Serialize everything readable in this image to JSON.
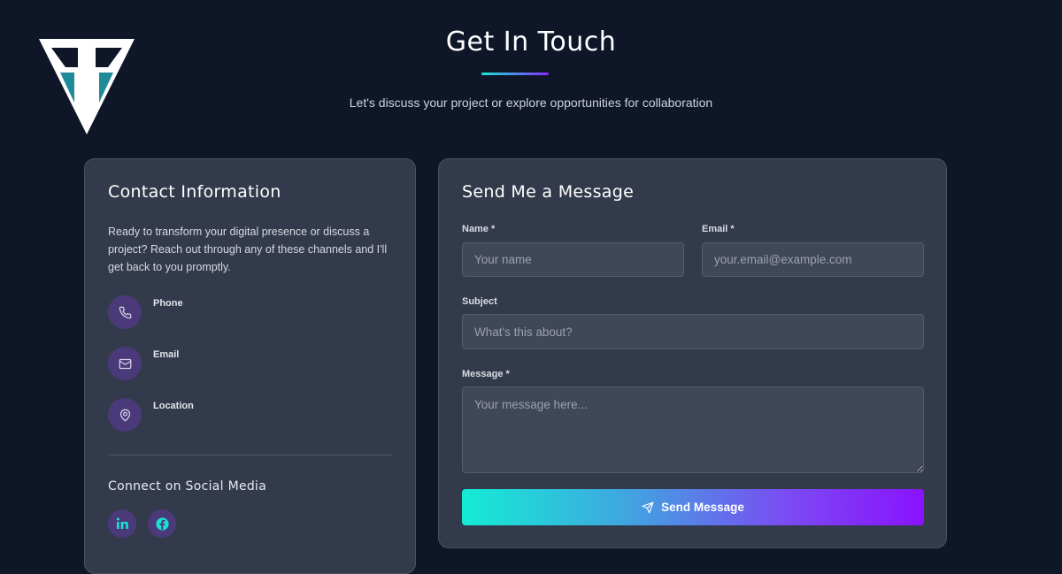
{
  "header": {
    "title": "Get In Touch",
    "subtitle": "Let's discuss your project or explore opportunities for collaboration"
  },
  "contact_info": {
    "title": "Contact Information",
    "intro": "Ready to transform your digital presence or discuss a project? Reach out through any of these channels and I'll get back to you promptly.",
    "items": [
      {
        "label": "Phone",
        "icon": "phone-icon"
      },
      {
        "label": "Email",
        "icon": "mail-icon"
      },
      {
        "label": "Location",
        "icon": "map-pin-icon"
      }
    ],
    "social": {
      "title": "Connect on Social Media",
      "links": [
        {
          "icon": "linkedin-icon"
        },
        {
          "icon": "facebook-icon"
        }
      ]
    }
  },
  "form": {
    "title": "Send Me a Message",
    "name": {
      "label": "Name *",
      "placeholder": "Your name"
    },
    "email": {
      "label": "Email *",
      "placeholder": "your.email@example.com"
    },
    "subject": {
      "label": "Subject",
      "placeholder": "What's this about?"
    },
    "message": {
      "label": "Message *",
      "placeholder": "Your message here..."
    },
    "submit_label": "Send Message"
  },
  "colors": {
    "background": "#0e1628",
    "card": "#333a4b",
    "icon_circle": "#4b3a7a",
    "accent_cyan": "#14e6d2",
    "accent_purple": "#8a12ff"
  }
}
